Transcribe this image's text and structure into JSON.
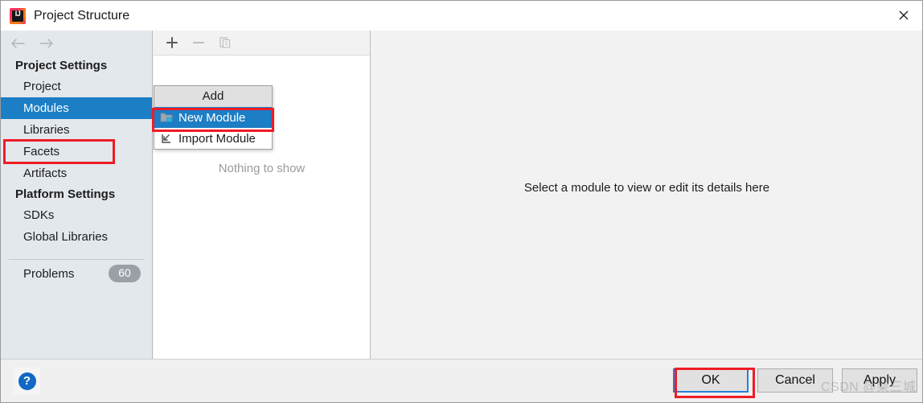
{
  "window": {
    "title": "Project Structure",
    "app_icon": "intellij-idea-icon",
    "close_label": "✕"
  },
  "navigation": {
    "back_icon": "arrow-left-icon",
    "forward_icon": "arrow-right-icon"
  },
  "sidebar": {
    "sections": [
      {
        "heading": "Project Settings",
        "items": [
          {
            "label": "Project",
            "selected": false
          },
          {
            "label": "Modules",
            "selected": true
          },
          {
            "label": "Libraries",
            "selected": false
          },
          {
            "label": "Facets",
            "selected": false
          },
          {
            "label": "Artifacts",
            "selected": false
          }
        ]
      },
      {
        "heading": "Platform Settings",
        "items": [
          {
            "label": "SDKs",
            "selected": false
          },
          {
            "label": "Global Libraries",
            "selected": false
          }
        ]
      }
    ],
    "problems": {
      "label": "Problems",
      "count": "60"
    }
  },
  "middle_panel": {
    "toolbar": {
      "add_icon": "plus-icon",
      "remove_icon": "minus-icon",
      "copy_icon": "copy-icon"
    },
    "empty_text": "Nothing to show"
  },
  "add_menu": {
    "header": "Add",
    "items": [
      {
        "label": "New Module",
        "icon": "folder-add-icon",
        "highlighted": true
      },
      {
        "label": "Import Module",
        "icon": "import-arrow-icon",
        "highlighted": false
      }
    ]
  },
  "detail_panel": {
    "message": "Select a module to view or edit its details here"
  },
  "footer": {
    "help_label": "?",
    "buttons": [
      {
        "label": "OK",
        "focused": true
      },
      {
        "label": "Cancel",
        "focused": false
      },
      {
        "label": "Apply",
        "focused": false
      }
    ]
  },
  "watermark": {
    "text": "CSDN @架三城"
  },
  "colors": {
    "accent_blue": "#1c7ec4",
    "highlight_red": "#ee1c25",
    "sidebar_bg": "#e3e8ed",
    "panel_bg": "#f2f2f2",
    "focus_blue": "#2481d7",
    "badge_grey": "#9aa0a6"
  }
}
